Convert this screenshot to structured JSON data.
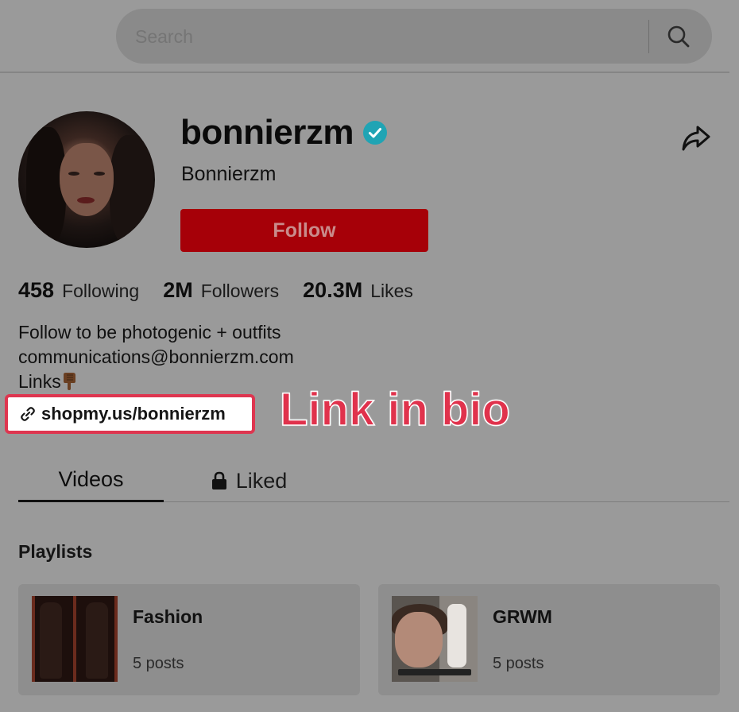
{
  "search": {
    "placeholder": "Search",
    "value": ""
  },
  "profile": {
    "username": "bonnierzm",
    "display_name": "Bonnierzm",
    "verified": true,
    "follow_label": "Follow",
    "stats": [
      {
        "value": "458",
        "label": "Following"
      },
      {
        "value": "2M",
        "label": "Followers"
      },
      {
        "value": "20.3M",
        "label": "Likes"
      }
    ],
    "bio": {
      "line1": "Follow to be photogenic + outfits",
      "line2": "communications@bonnierzm.com",
      "line3": "Links"
    },
    "link": "shopmy.us/bonnierzm"
  },
  "annotation": "Link in bio",
  "tabs": {
    "videos": "Videos",
    "liked": "Liked"
  },
  "playlists": {
    "title": "Playlists",
    "items": [
      {
        "name": "Fashion",
        "count": "5 posts"
      },
      {
        "name": "GRWM",
        "count": "5 posts"
      }
    ]
  },
  "colors": {
    "follow_button": "#a60008",
    "verified_badge": "#20a4b4",
    "annotation": "#e0324c",
    "link_border": "#de3650"
  }
}
